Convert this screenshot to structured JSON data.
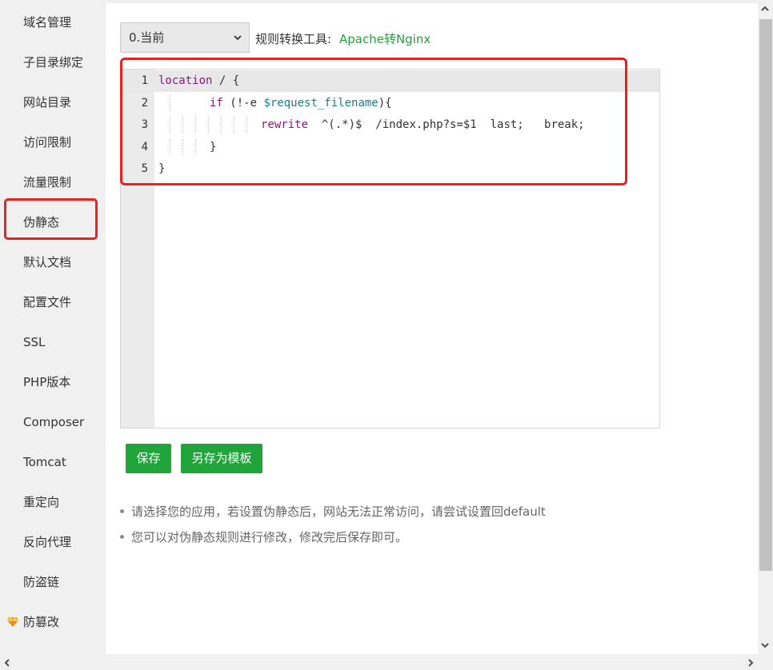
{
  "sidebar": {
    "items": [
      {
        "label": "域名管理"
      },
      {
        "label": "子目录绑定"
      },
      {
        "label": "网站目录"
      },
      {
        "label": "访问限制"
      },
      {
        "label": "流量限制"
      },
      {
        "label": "伪静态"
      },
      {
        "label": "默认文档"
      },
      {
        "label": "配置文件"
      },
      {
        "label": "SSL"
      },
      {
        "label": "PHP版本"
      },
      {
        "label": "Composer"
      },
      {
        "label": "Tomcat"
      },
      {
        "label": "重定向"
      },
      {
        "label": "反向代理"
      },
      {
        "label": "防盗链"
      },
      {
        "label": "防篡改",
        "icon": "gem-icon"
      }
    ],
    "active": "伪静态"
  },
  "rewrite": {
    "select_value": "0.当前",
    "tool_label": "规则转换工具:",
    "tool_link": "Apache转Nginx"
  },
  "editor": {
    "line_numbers": [
      "1",
      "2",
      "3",
      "4",
      "5"
    ],
    "lines": [
      {
        "tokens": [
          {
            "t": "location",
            "c": "kw"
          },
          {
            "t": " / {",
            "c": ""
          }
        ]
      },
      {
        "tokens": [
          {
            "t": "if",
            "c": "kw"
          },
          {
            "t": " (!-e ",
            "c": ""
          },
          {
            "t": "$request_filename",
            "c": "var"
          },
          {
            "t": "){",
            "c": ""
          }
        ]
      },
      {
        "tokens": [
          {
            "t": "rewrite",
            "c": "kw"
          },
          {
            "t": "  ^(.*)$  /index.php?s=$1  last;   break;",
            "c": ""
          }
        ]
      },
      {
        "tokens": [
          {
            "t": "}",
            "c": ""
          }
        ]
      },
      {
        "tokens": [
          {
            "t": "}",
            "c": ""
          }
        ]
      }
    ]
  },
  "buttons": {
    "save": "保存",
    "save_as_template": "另存为模板"
  },
  "tips": [
    "请选择您的应用，若设置伪静态后，网站无法正常访问，请尝试设置回default",
    "您可以对伪静态规则进行修改，修改完后保存即可。"
  ],
  "colors": {
    "accent_green": "#20a53a",
    "highlight_red": "#e8221e",
    "keyword": "#8f1681",
    "variable": "#1a7e8b"
  }
}
